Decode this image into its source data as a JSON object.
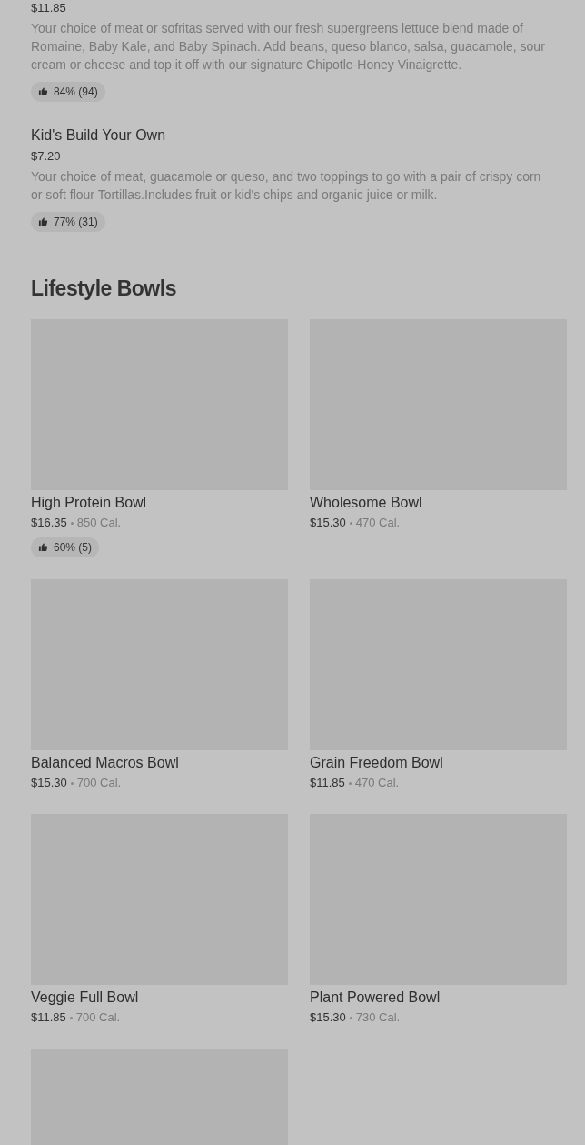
{
  "top_items": [
    {
      "price": "$11.85",
      "description": "Your choice of meat or sofritas served with our fresh supergreens lettuce blend made of Romaine, Baby Kale, and Baby Spinach. Add beans, queso blanco, salsa, guacamole, sour cream or cheese and top it off with our signature Chipotle-Honey Vinaigrette.",
      "rating": "84% (94)"
    },
    {
      "name": "Kid's Build Your Own",
      "price": "$7.20",
      "description": "Your choice of meat, guacamole or queso, and two toppings to go with a pair of crispy corn or soft flour Tortillas.Includes fruit or kid's chips and organic juice or milk.",
      "rating": "77% (31)"
    }
  ],
  "section": {
    "title": "Lifestyle Bowls",
    "items": [
      {
        "kind": "item",
        "name": "High Protein Bowl",
        "price": "$16.35",
        "calories": "850 Cal.",
        "rating": "60% (5)"
      },
      {
        "kind": "item",
        "name": "Wholesome Bowl",
        "price": "$15.30",
        "calories": "470 Cal."
      },
      {
        "kind": "item",
        "name": "Balanced Macros Bowl",
        "price": "$15.30",
        "calories": "700 Cal."
      },
      {
        "kind": "item",
        "name": "Grain Freedom Bowl",
        "price": "$11.85",
        "calories": "470 Cal."
      },
      {
        "kind": "item",
        "name": "Veggie Full Bowl",
        "price": "$11.85",
        "calories": "700 Cal."
      },
      {
        "kind": "item",
        "name": "Plant Powered Bowl",
        "price": "$15.30",
        "calories": "730 Cal."
      },
      {
        "kind": "image_only"
      }
    ]
  }
}
